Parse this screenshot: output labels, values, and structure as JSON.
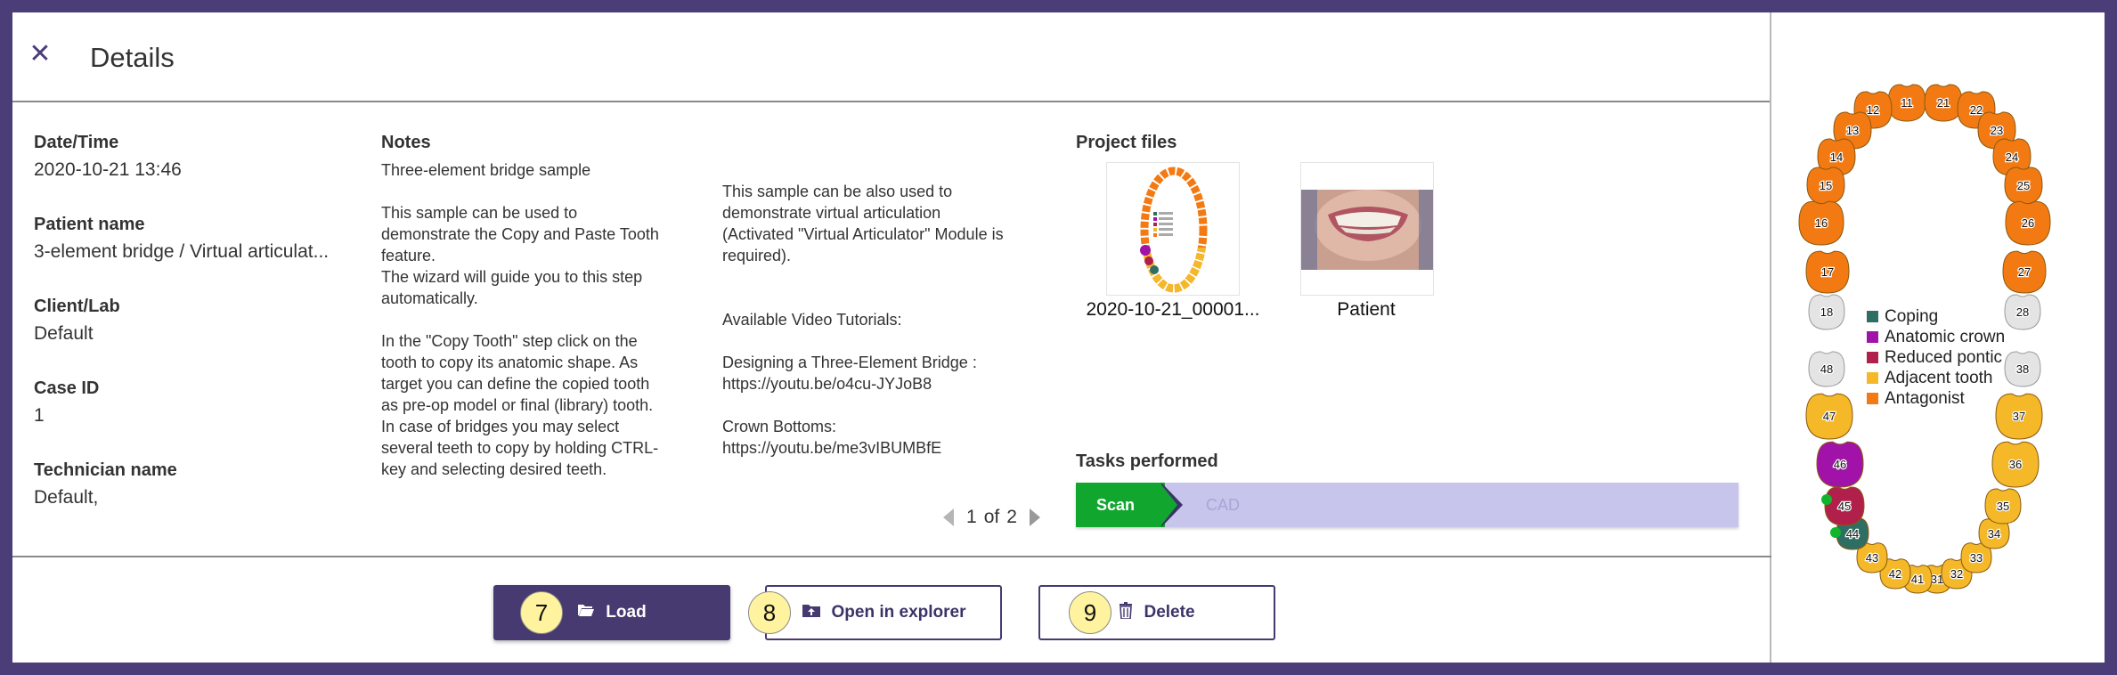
{
  "header": {
    "title": "Details",
    "close_icon": "close-icon"
  },
  "info": {
    "date_label": "Date/Time",
    "date_value": "2020-10-21 13:46",
    "patient_label": "Patient name",
    "patient_value": "3-element bridge / Virtual articulat...",
    "client_label": "Client/Lab",
    "client_value": "Default",
    "case_label": "Case ID",
    "case_value": "1",
    "tech_label": "Technician name",
    "tech_value": "Default,"
  },
  "notes": {
    "title": "Notes",
    "page_a": "Three-element bridge sample\n\nThis sample can be used to\ndemonstrate the Copy and Paste Tooth\nfeature.\nThe wizard will guide you to this step\nautomatically.\n\nIn the \"Copy Tooth\" step click on the\ntooth to copy its anatomic shape. As\ntarget you can define the copied tooth\nas pre-op model or final (library) tooth.\nIn case of bridges you may select\nseveral teeth to copy by holding CTRL-\nkey and selecting desired teeth.",
    "page_b": "This sample can be also used to\ndemonstrate virtual articulation\n(Activated \"Virtual Articulator\" Module is\nrequired).\n\n\nAvailable Video Tutorials:\n\nDesigning a Three-Element Bridge :\nhttps://youtu.be/o4cu-JYJoB8\n\nCrown Bottoms:\nhttps://youtu.be/me3vIBUMBfE",
    "pager": {
      "current": "1",
      "of": "of",
      "total": "2"
    }
  },
  "project_files": {
    "title": "Project files",
    "files": [
      {
        "caption": "2020-10-21_00001...",
        "icon": "tooth-chart-thumbnail"
      },
      {
        "caption": "Patient",
        "icon": "patient-photo-thumbnail"
      }
    ]
  },
  "tasks": {
    "title": "Tasks performed",
    "scan": "Scan",
    "cad": "CAD"
  },
  "buttons": {
    "load": "Load",
    "load_icon": "folder-open-icon",
    "load_badge": "7",
    "open": "Open in explorer",
    "open_icon": "upload-folder-icon",
    "open_badge": "8",
    "delete": "Delete",
    "delete_icon": "trash-icon",
    "delete_badge": "9"
  },
  "tooth_chart": {
    "legend": [
      {
        "label": "Coping",
        "color": "#2e6e63"
      },
      {
        "label": "Anatomic crown",
        "color": "#a012a8"
      },
      {
        "label": "Reduced pontic",
        "color": "#b0204a"
      },
      {
        "label": "Adjacent tooth",
        "color": "#f4b828"
      },
      {
        "label": "Antagonist",
        "color": "#f37a12"
      }
    ],
    "teeth": [
      {
        "n": "11",
        "type": "antagonist"
      },
      {
        "n": "12",
        "type": "antagonist"
      },
      {
        "n": "13",
        "type": "antagonist"
      },
      {
        "n": "14",
        "type": "antagonist"
      },
      {
        "n": "15",
        "type": "antagonist"
      },
      {
        "n": "16",
        "type": "antagonist"
      },
      {
        "n": "17",
        "type": "antagonist"
      },
      {
        "n": "18",
        "type": "none"
      },
      {
        "n": "21",
        "type": "antagonist"
      },
      {
        "n": "22",
        "type": "antagonist"
      },
      {
        "n": "23",
        "type": "antagonist"
      },
      {
        "n": "24",
        "type": "antagonist"
      },
      {
        "n": "25",
        "type": "antagonist"
      },
      {
        "n": "26",
        "type": "antagonist"
      },
      {
        "n": "27",
        "type": "antagonist"
      },
      {
        "n": "28",
        "type": "none"
      },
      {
        "n": "31",
        "type": "adjacent"
      },
      {
        "n": "32",
        "type": "adjacent"
      },
      {
        "n": "33",
        "type": "adjacent"
      },
      {
        "n": "34",
        "type": "adjacent"
      },
      {
        "n": "35",
        "type": "adjacent"
      },
      {
        "n": "36",
        "type": "adjacent"
      },
      {
        "n": "37",
        "type": "adjacent"
      },
      {
        "n": "38",
        "type": "none"
      },
      {
        "n": "41",
        "type": "adjacent"
      },
      {
        "n": "42",
        "type": "adjacent"
      },
      {
        "n": "43",
        "type": "adjacent"
      },
      {
        "n": "44",
        "type": "coping"
      },
      {
        "n": "45",
        "type": "pontic"
      },
      {
        "n": "46",
        "type": "crown"
      },
      {
        "n": "47",
        "type": "adjacent"
      },
      {
        "n": "48",
        "type": "none"
      }
    ],
    "colors": {
      "none": "#e4e4e4",
      "antagonist": "#f37a12",
      "adjacent": "#f4b828",
      "coping": "#2e6e63",
      "pontic": "#b0204a",
      "crown": "#a012a8",
      "connector": "#10b52c"
    }
  }
}
